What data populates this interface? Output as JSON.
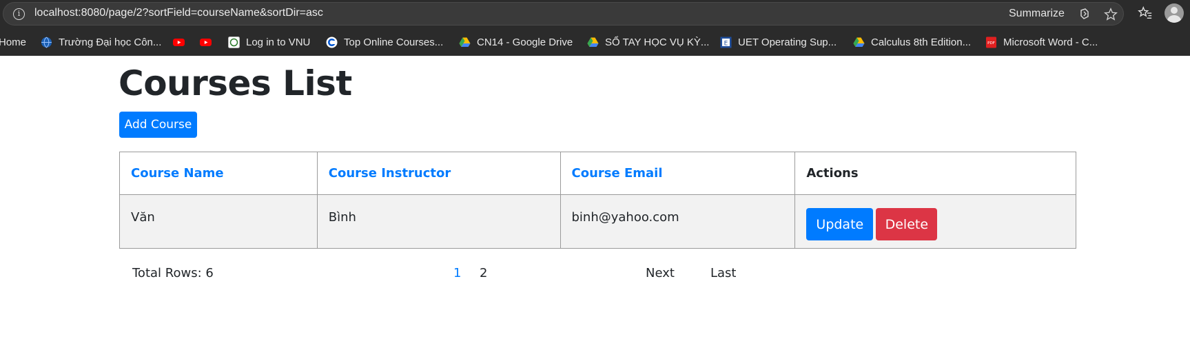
{
  "browser": {
    "url": "localhost:8080/page/2?sortField=courseName&sortDir=asc",
    "summarize_label": "Summarize"
  },
  "bookmarks": [
    {
      "label": "Home",
      "icon": "none"
    },
    {
      "label": "Trường Đại học Côn...",
      "icon": "globe-icon"
    },
    {
      "label": "",
      "icon": "youtube-icon"
    },
    {
      "label": "",
      "icon": "youtube-icon"
    },
    {
      "label": "Log in to VNU",
      "icon": "vnu-icon"
    },
    {
      "label": "Top Online Courses...",
      "icon": "coursera-icon"
    },
    {
      "label": "CN14 - Google Drive",
      "icon": "google-drive-icon"
    },
    {
      "label": "SỔ TAY HỌC VỤ KỲ...",
      "icon": "google-drive-icon"
    },
    {
      "label": "UET Operating Sup...",
      "icon": "uet-icon"
    },
    {
      "label": "Calculus 8th Edition...",
      "icon": "google-drive-icon"
    },
    {
      "label": "Microsoft Word - C...",
      "icon": "pdf-icon"
    }
  ],
  "page": {
    "title": "Courses List",
    "add_button": "Add Course"
  },
  "table": {
    "headers": [
      "Course Name",
      "Course Instructor",
      "Course Email",
      "Actions"
    ],
    "rows": [
      {
        "name": "Văn",
        "instructor": "Bình",
        "email": "binh@yahoo.com"
      }
    ],
    "update_label": "Update",
    "delete_label": "Delete"
  },
  "pagination": {
    "total_rows": "Total Rows: 6",
    "pages": [
      "1",
      "2"
    ],
    "next_label": "Next",
    "last_label": "Last"
  },
  "colors": {
    "primary": "#007bff",
    "danger": "#dc3545",
    "chrome_bg": "#2b2b2b"
  }
}
